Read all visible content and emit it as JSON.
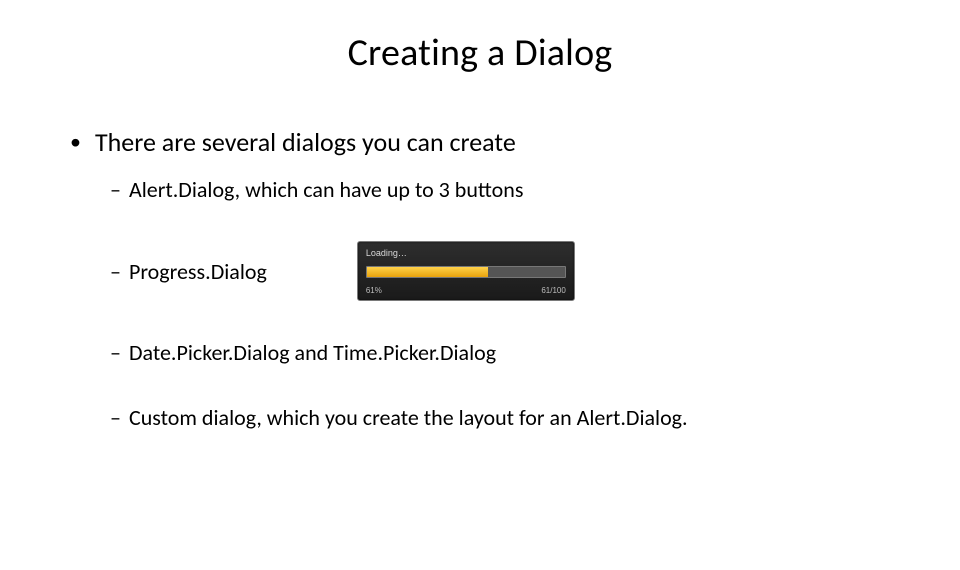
{
  "title": "Creating a Dialog",
  "bullet": "There are several dialogs you can create",
  "sub1": "Alert.Dialog, which can have up to 3 buttons",
  "sub2": "Progress.Dialog",
  "sub3": "Date.Picker.Dialog and Time.Picker.Dialog",
  "sub4": "Custom dialog, which you create the layout for an Alert.Dialog.",
  "progress": {
    "label": "Loading…",
    "percent_text": "61%",
    "count_text": "61/100",
    "percent_value": 61
  }
}
